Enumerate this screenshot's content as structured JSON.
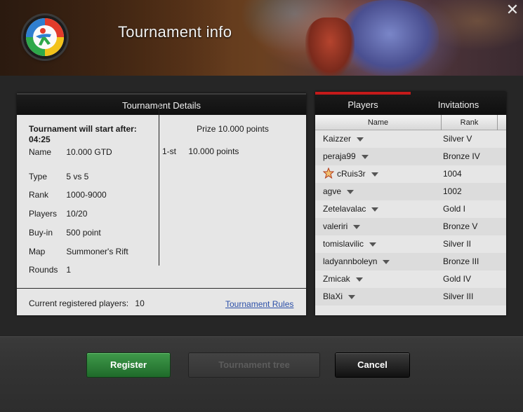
{
  "window": {
    "title": "Tournament info",
    "close_glyph": "✕"
  },
  "details": {
    "header": "Tournament Details",
    "start_label": "Tournament will start after: 04:25",
    "fields": [
      {
        "key": "Name",
        "value": "10.000 GTD"
      },
      {
        "key": "Type",
        "value": "5 vs 5"
      },
      {
        "key": "Rank",
        "value": "1000-9000"
      },
      {
        "key": "Players",
        "value": "10/20"
      },
      {
        "key": "Buy-in",
        "value": "500 point"
      },
      {
        "key": "Map",
        "value": "Summoner's Rift"
      },
      {
        "key": "Rounds",
        "value": "1"
      }
    ],
    "prize_title": "Prize 10.000 points",
    "prizes": [
      {
        "place": "1-st",
        "amount": "10.000 points"
      }
    ],
    "registered_label": "Current registered players:",
    "registered_count": "10",
    "rules_link": "Tournament Rules"
  },
  "players_panel": {
    "tabs": [
      {
        "label": "Players",
        "active": true
      },
      {
        "label": "Invitations",
        "active": false
      }
    ],
    "columns": [
      "Name",
      "Rank"
    ],
    "rows": [
      {
        "name": "Kaizzer",
        "rank": "Silver V",
        "star": false
      },
      {
        "name": "peraja99",
        "rank": "Bronze IV",
        "star": false
      },
      {
        "name": "cRuis3r",
        "rank": "1004",
        "star": true
      },
      {
        "name": "agve",
        "rank": "1002",
        "star": false
      },
      {
        "name": "Zetelavalac",
        "rank": "Gold I",
        "star": false
      },
      {
        "name": "valeriri",
        "rank": "Bronze V",
        "star": false
      },
      {
        "name": "tomislavilic",
        "rank": "Silver II",
        "star": false
      },
      {
        "name": "ladyannboleyn",
        "rank": "Bronze III",
        "star": false
      },
      {
        "name": "Zmicak",
        "rank": "Gold IV",
        "star": false
      },
      {
        "name": "BlaXi",
        "rank": "Silver III",
        "star": false
      }
    ]
  },
  "buttons": {
    "register": "Register",
    "tree": "Tournament tree",
    "cancel": "Cancel"
  },
  "colors": {
    "accent_red": "#c41a1a",
    "register_green": "#2e8a3a",
    "link_blue": "#2b4fa8"
  },
  "icons": {
    "logo": "app-logo",
    "close": "close-icon",
    "star": "star-icon",
    "caret": "chevron-down-icon"
  }
}
